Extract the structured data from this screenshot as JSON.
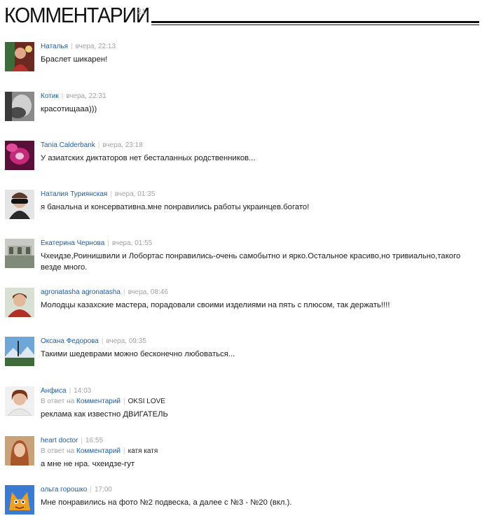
{
  "header": {
    "title": "КОММЕНТАРИИ",
    "count": "21"
  },
  "comments": [
    {
      "author": "Наталья",
      "time": "вчера, 22:13",
      "text": "Браслет шикарен!"
    },
    {
      "author": "Котик",
      "time": "вчера, 22:31",
      "text": "красотищааа)))"
    },
    {
      "author": "Tania Calderbank",
      "time": "вчера, 23:18",
      "text": "У азиатских диктаторов нет бесталанных родственников..."
    },
    {
      "author": "Наталия Туриянская",
      "time": "вчера, 01:35",
      "text": "я банальна и консервативна.мне понравились работы украинцев.богато!"
    },
    {
      "author": "Екатерина Чернова",
      "time": "вчера, 01:55",
      "text": "Чхеидзе,Роинишвили и Лобортас понравились-очень самобытно и ярко.Остальное красиво,но тривиально,такого везде много."
    },
    {
      "author": "agronatasha agronatasha",
      "time": "вчера, 08:46",
      "text": "Молодцы казахские мастера, порадовали своими изделиями на пять с плюсом, так держать!!!!"
    },
    {
      "author": "Оксана Федорова",
      "time": "вчера, 09:35",
      "text": "Такими шедеврами можно бесконечно любоваться..."
    },
    {
      "author": "Анфиса",
      "time": "14:03",
      "reply_prefix": "В ответ на",
      "reply_link": "Комментарий",
      "reply_user": "OKSI LOVE",
      "text": "реклама как известно ДВИГАТЕЛЬ"
    },
    {
      "author": "heart doctor",
      "time": "16:55",
      "reply_prefix": "В ответ на",
      "reply_link": "Комментарий",
      "reply_user": "катя катя",
      "text": "а мне не нра. чхеидзе-гут"
    },
    {
      "author": "ольга горошко",
      "time": "17:00",
      "text": "Мне понравились на фото №2 подвеска, а далее с №3 - №20 (вкл.)."
    }
  ]
}
